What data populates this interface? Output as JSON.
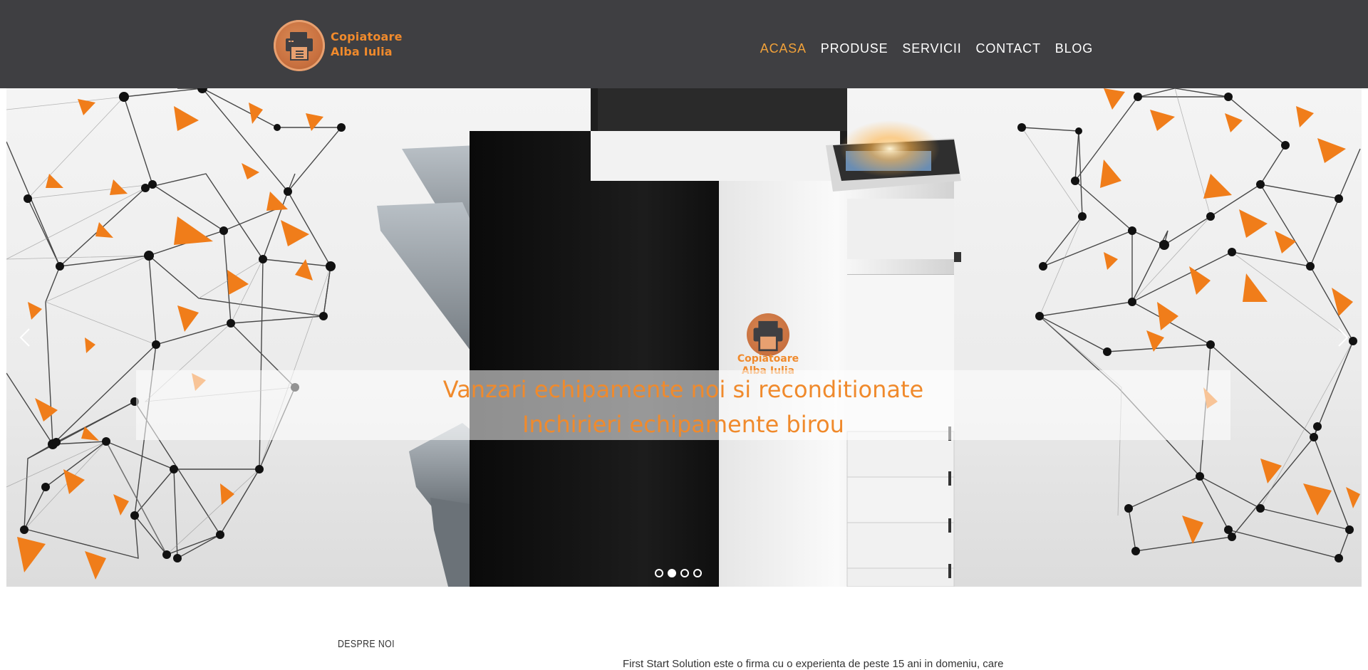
{
  "brand": {
    "name_line1": "Copiatoare",
    "name_line2": "Alba Iulia",
    "accent": "#f08a2c",
    "header_bg": "#3f3f42"
  },
  "nav": {
    "items": [
      {
        "label": "ACASA",
        "active": true
      },
      {
        "label": "PRODUSE",
        "active": false
      },
      {
        "label": "SERVICII",
        "active": false
      },
      {
        "label": "CONTACT",
        "active": false
      },
      {
        "label": "BLOG",
        "active": false
      }
    ]
  },
  "slider": {
    "caption_line1": "Vanzari echipamente noi si reconditionate",
    "caption_line2": "Inchirieri echipamente birou",
    "logo_line1": "Copiatoare",
    "logo_line2": "Alba Iulia",
    "prev_icon": "chevron-left-icon",
    "next_icon": "chevron-right-icon",
    "dots_total": 4,
    "dots_active": 2
  },
  "about": {
    "heading": "DESPRE NOI",
    "text": "First Start Solution este o firma cu o experienta de peste 15 ani in domeniu, care"
  }
}
